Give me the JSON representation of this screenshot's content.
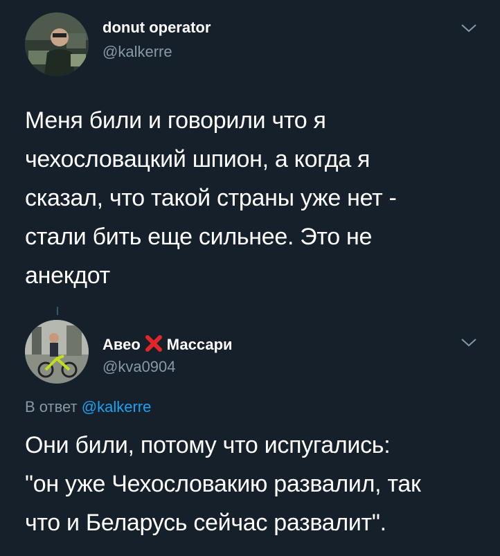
{
  "tweet1": {
    "author_name": "donut operator",
    "author_handle": "@kalkerre",
    "text_lines": [
      "Меня били и говорили что я",
      "чехословацкий шпион, а когда я",
      "сказал, что такой страны уже нет -",
      "стали бить еще сильнее. Это не",
      "анекдот"
    ]
  },
  "tweet2": {
    "author_name_part1": "Авео",
    "author_name_emoji": "cross-mark-icon",
    "author_name_part2": "Массари",
    "author_handle": "@kva0904",
    "reply_prefix": "В ответ",
    "reply_handle": "@kalkerre",
    "text_lines": [
      "Они били, потому что испугались:",
      "\"он уже Чехословакию развалил, так",
      "что и Беларусь сейчас развалит\"."
    ]
  },
  "colors": {
    "background": "#15202b",
    "secondary_text": "#8899a6",
    "link": "#1da1f2",
    "emoji_red": "#e0262a"
  }
}
